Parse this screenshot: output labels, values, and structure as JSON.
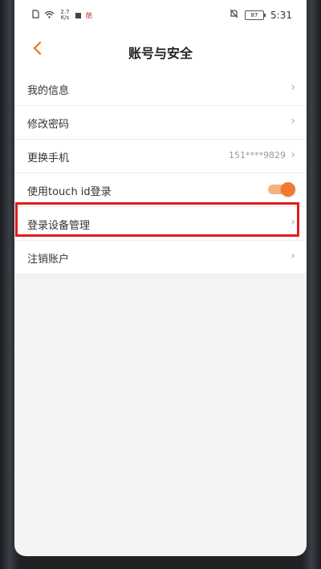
{
  "status_bar": {
    "net_speed_value": "2.7",
    "net_speed_unit": "K/s",
    "notif_badge": "酷",
    "battery": "87",
    "time": "5:31"
  },
  "navbar": {
    "title": "账号与安全"
  },
  "menu": {
    "items": [
      {
        "label": "我的信息"
      },
      {
        "label": "修改密码"
      },
      {
        "label": "更换手机",
        "value": "151****9829"
      },
      {
        "label": "使用touch id登录",
        "toggle": true
      },
      {
        "label": "登录设备管理",
        "highlighted": true
      },
      {
        "label": "注销账户"
      }
    ]
  },
  "colors": {
    "accent": "#ef7a2f",
    "highlight": "#e11c1c"
  }
}
